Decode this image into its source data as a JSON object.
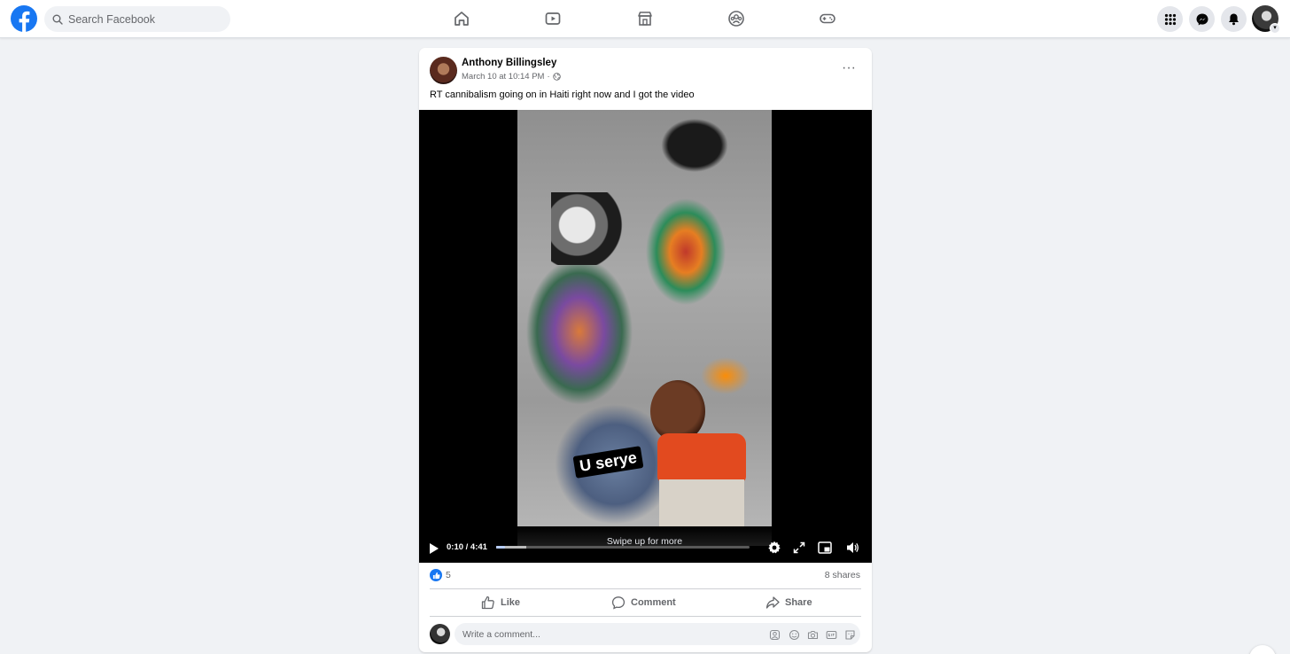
{
  "header": {
    "search": {
      "placeholder": "Search Facebook"
    },
    "nav_icons": [
      "home-icon",
      "watch-icon",
      "marketplace-icon",
      "groups-icon",
      "gaming-icon"
    ],
    "right_icons": [
      "menu-grid-icon",
      "messenger-icon",
      "notifications-bell-icon"
    ],
    "brand_color": "#1877f2"
  },
  "post": {
    "author": "Anthony Billingsley",
    "timestamp": "March 10 at 10:14 PM",
    "separator": "·",
    "audience_icon": "globe-icon",
    "more_label": "···",
    "text": "RT cannibalism going on in Haiti right now and I got the video",
    "video": {
      "sticker_caption": "U serye",
      "swipe_text": "Swipe up for more",
      "time": "0:10 / 4:41",
      "progress_fraction": 0.036,
      "buffer_fraction": 0.12
    },
    "reactions": {
      "like_count": "5",
      "shares": "8 shares"
    },
    "actions": {
      "like": "Like",
      "comment": "Comment",
      "share": "Share"
    },
    "comment": {
      "placeholder": "Write a comment..."
    }
  }
}
